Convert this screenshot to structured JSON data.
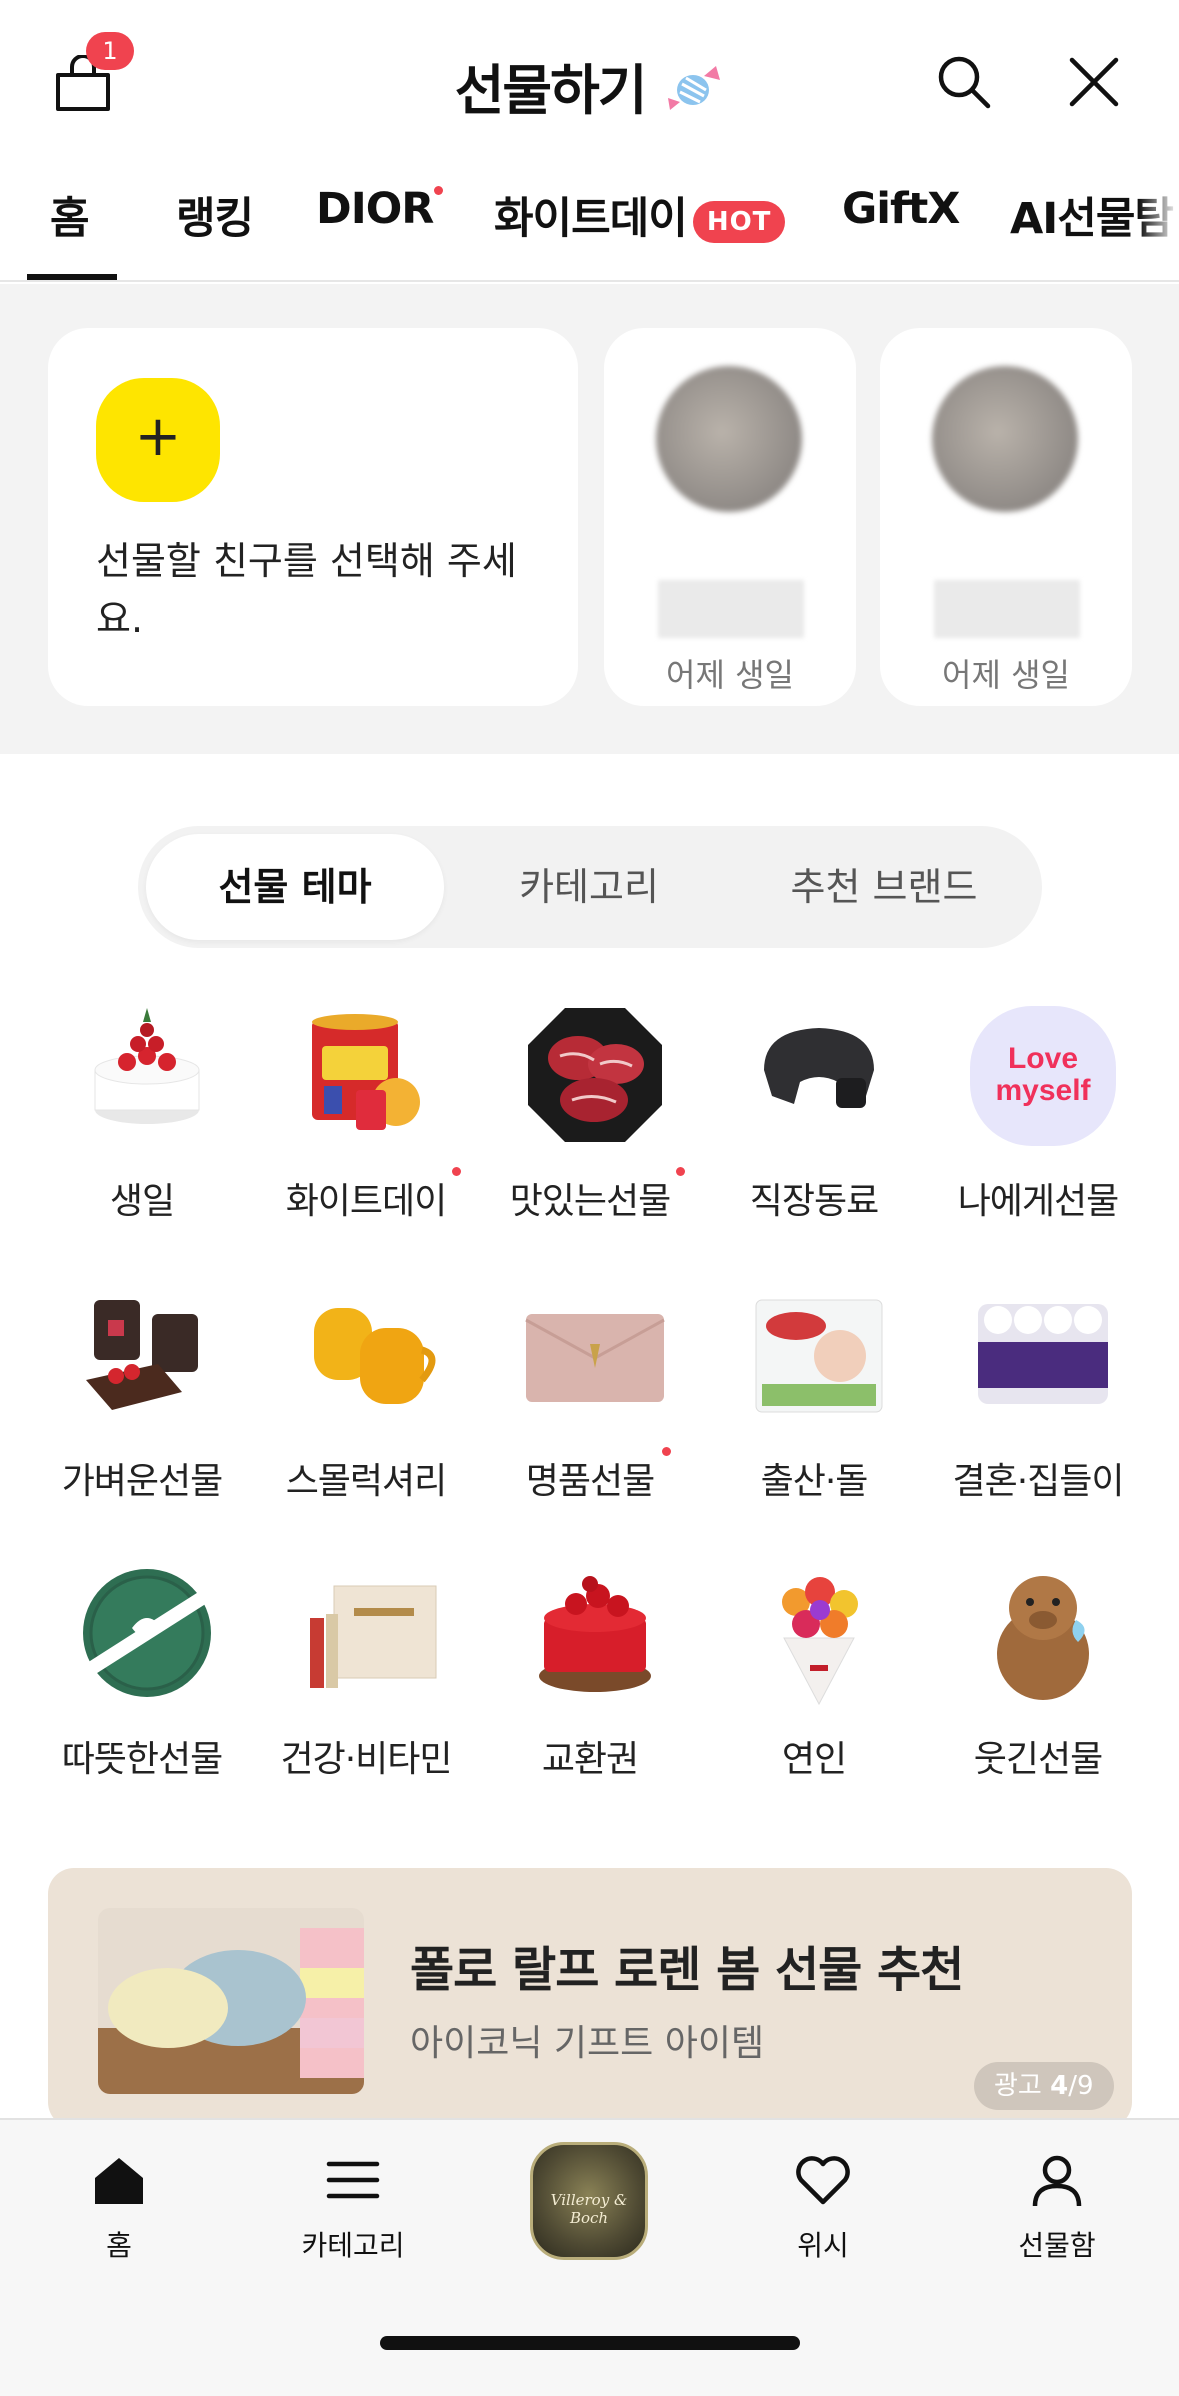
{
  "header": {
    "title": "선물하기",
    "cart_badge": "1"
  },
  "tabs": [
    {
      "label": "홈",
      "active": true
    },
    {
      "label": "랭킹"
    },
    {
      "label": "DIOR",
      "dot": true
    },
    {
      "label": "화이트데이",
      "badge": "HOT"
    },
    {
      "label": "GiftX"
    },
    {
      "label": "AI선물탐"
    }
  ],
  "friends": {
    "add_text": "선물할 친구를 선택해 주세요.",
    "items": [
      {
        "status": "어제 생일"
      },
      {
        "status": "어제 생일"
      }
    ]
  },
  "segments": [
    "선물 테마",
    "카테고리",
    "추천 브랜드"
  ],
  "themes": [
    {
      "label": "생일",
      "icon": "birthday-cake"
    },
    {
      "label": "화이트데이",
      "icon": "candy-tin",
      "dot": true
    },
    {
      "label": "맛있는선물",
      "icon": "beef",
      "dot": true
    },
    {
      "label": "직장동료",
      "icon": "neck-massager"
    },
    {
      "label": "나에게선물",
      "icon": "love-myself",
      "text": "Love myself"
    },
    {
      "label": "가벼운선물",
      "icon": "coffee-cake"
    },
    {
      "label": "스몰럭셔리",
      "icon": "yellow-cups"
    },
    {
      "label": "명품선물",
      "icon": "wallet",
      "dot": true
    },
    {
      "label": "출산·돌",
      "icon": "diapers"
    },
    {
      "label": "결혼·집들이",
      "icon": "tissue"
    },
    {
      "label": "따뜻한선물",
      "icon": "gift-box"
    },
    {
      "label": "건강·비타민",
      "icon": "vitamin"
    },
    {
      "label": "교환권",
      "icon": "strawberry-cake"
    },
    {
      "label": "연인",
      "icon": "flowers"
    },
    {
      "label": "웃긴선물",
      "icon": "capybara"
    }
  ],
  "banner": {
    "title": "폴로 랄프 로렌 봄 선물 추천",
    "subtitle": "아이코닉 기프트 아이템",
    "ad_label": "광고",
    "current": "4",
    "total": "/9"
  },
  "bottom_nav": [
    {
      "label": "홈",
      "icon": "home-icon"
    },
    {
      "label": "카테고리",
      "icon": "menu-icon"
    },
    {
      "label": "",
      "icon": "brand-logo",
      "logo_text": "Villeroy & Boch"
    },
    {
      "label": "위시",
      "icon": "heart-icon"
    },
    {
      "label": "선물함",
      "icon": "person-icon"
    }
  ]
}
